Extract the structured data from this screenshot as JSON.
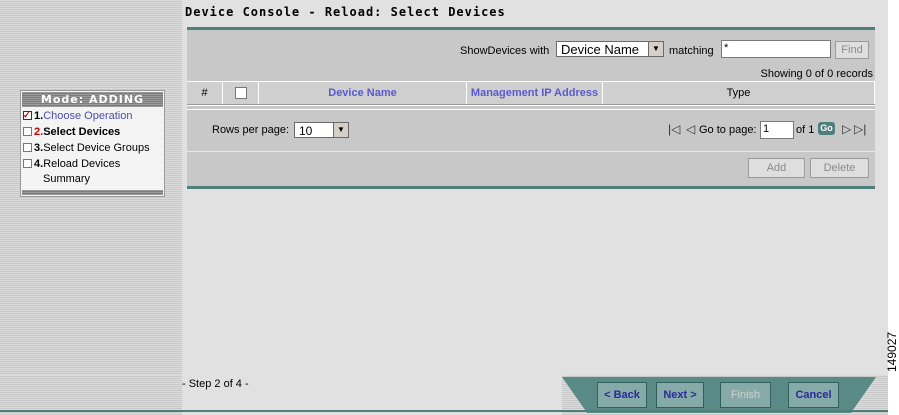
{
  "page": {
    "title": "Device Console - Reload: Select Devices",
    "step_info": "- Step 2 of 4 -",
    "figure_id": "149027"
  },
  "wizard": {
    "mode": "Mode: ADDING",
    "steps": [
      {
        "num": "1.",
        "label": "Choose Operation",
        "state": "done"
      },
      {
        "num": "2.",
        "label": "Select Devices",
        "state": "current"
      },
      {
        "num": "3.",
        "label": "Select Device Groups",
        "state": "pending"
      },
      {
        "num": "4.",
        "label": "Reload Devices",
        "state": "pending",
        "sublabel": "Summary"
      }
    ]
  },
  "filter": {
    "show_label": "ShowDevices with",
    "field_value": "Device Name",
    "matching_label": "matching",
    "match_value": "*",
    "find_label": "Find"
  },
  "records": "Showing 0 of 0 records",
  "table": {
    "columns": [
      "#",
      "",
      "Device Name",
      "Management IP Address",
      "Type"
    ]
  },
  "pager": {
    "rows_label": "Rows per page:",
    "rows_value": "10",
    "goto_label": "Go to page:",
    "page_value": "1",
    "of_label": "of 1",
    "go_label": "Go"
  },
  "actions": {
    "add_label": "Add",
    "delete_label": "Delete"
  },
  "nav": {
    "back_label": "< Back",
    "next_label": "Next >",
    "finish_label": "Finish",
    "cancel_label": "Cancel"
  },
  "colors": {
    "accent": "#4f7f7a",
    "link": "#5a5ad0",
    "current_step": "#cc0000"
  }
}
